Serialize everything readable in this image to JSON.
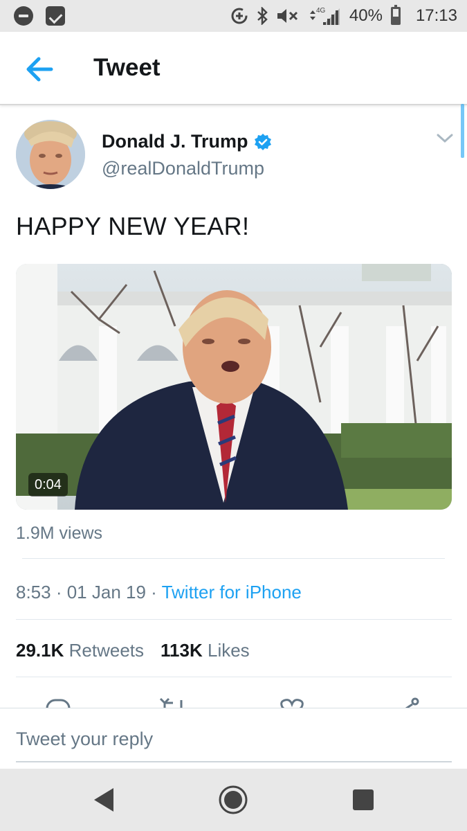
{
  "status_bar": {
    "network": "4G",
    "battery": "40%",
    "time": "17:13"
  },
  "header": {
    "title": "Tweet"
  },
  "tweet": {
    "author_name": "Donald J. Trump",
    "author_handle": "@realDonaldTrump",
    "text": "HAPPY NEW YEAR!",
    "video_duration": "0:04",
    "views": "1.9M views",
    "time": "8:53",
    "date": "01 Jan 19",
    "separator": " · ",
    "source": "Twitter for iPhone",
    "retweets_count": "29.1K",
    "retweets_label": "Retweets",
    "likes_count": "113K",
    "likes_label": "Likes"
  },
  "reply": {
    "placeholder": "Tweet your reply"
  },
  "colors": {
    "accent": "#1da1f2",
    "text_primary": "#14171a",
    "text_secondary": "#657786"
  }
}
